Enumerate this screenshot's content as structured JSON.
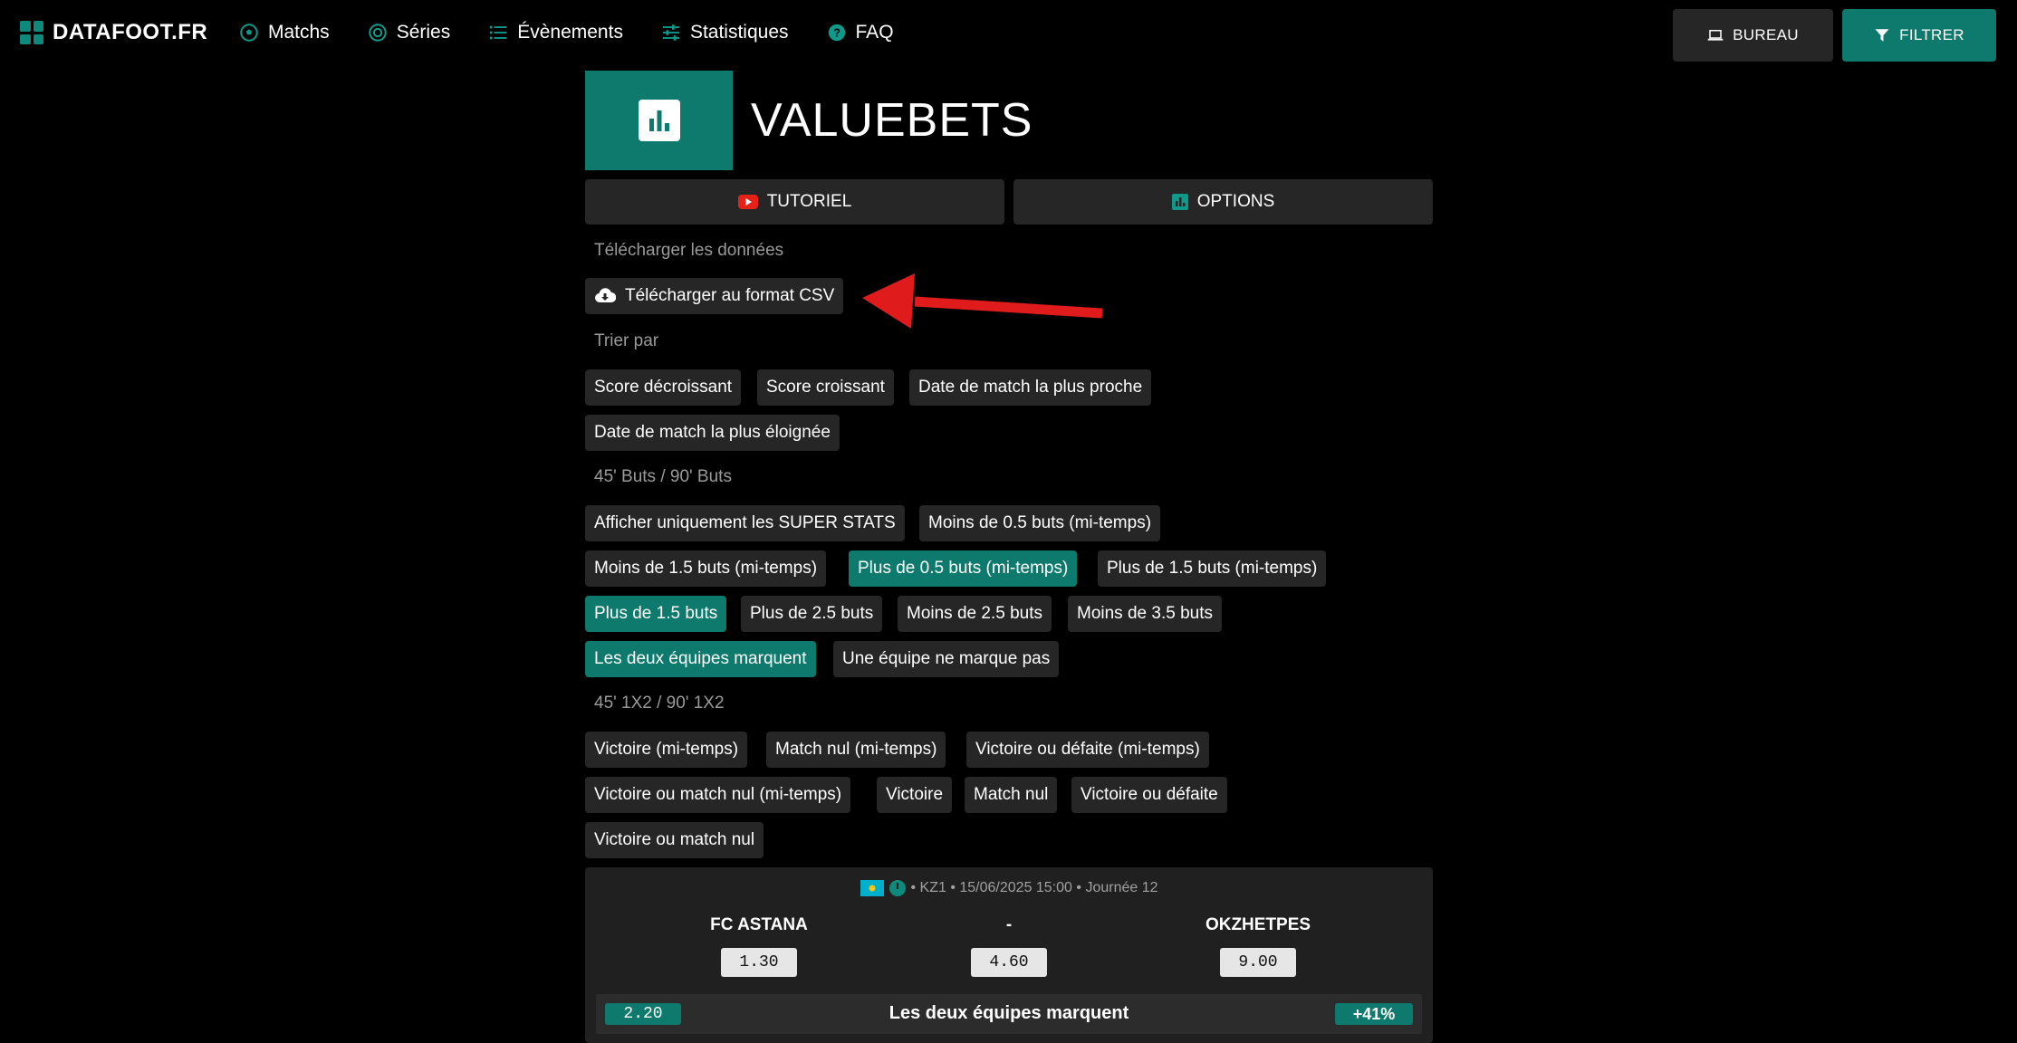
{
  "brand": "DATAFOOT.FR",
  "nav": [
    {
      "label": "Matchs",
      "icon": "soccer-ball-icon"
    },
    {
      "label": "Séries",
      "icon": "target-icon"
    },
    {
      "label": "Évènements",
      "icon": "list-icon"
    },
    {
      "label": "Statistiques",
      "icon": "sliders-icon"
    },
    {
      "label": "FAQ",
      "icon": "question-icon"
    }
  ],
  "top_buttons": {
    "bureau": "BUREAU",
    "filtrer": "FILTRER"
  },
  "page": {
    "title": "VALUEBETS"
  },
  "actions": {
    "tutoriel": "TUTORIEL",
    "options": "OPTIONS"
  },
  "download": {
    "label": "Télécharger les données",
    "button": "Télécharger au format CSV"
  },
  "sort": {
    "label": "Trier par",
    "options": [
      "Score décroissant",
      "Score croissant",
      "Date de match la plus proche",
      "Date de match la plus éloignée"
    ]
  },
  "goals": {
    "label": "45' Buts / 90' Buts",
    "options": [
      "Afficher uniquement les SUPER STATS",
      "Moins de 0.5 buts (mi-temps)",
      "Moins de 1.5 buts (mi-temps)",
      "Plus de 0.5 buts (mi-temps)",
      "Plus de 1.5 buts (mi-temps)",
      "Plus de 1.5 buts",
      "Plus de 2.5 buts",
      "Moins de 2.5 buts",
      "Moins de 3.5 buts",
      "Les deux équipes marquent",
      "Une équipe ne marque pas"
    ]
  },
  "results": {
    "label": "45' 1X2 / 90' 1X2",
    "options": [
      "Victoire (mi-temps)",
      "Match nul (mi-temps)",
      "Victoire ou défaite (mi-temps)",
      "Victoire ou match nul (mi-temps)",
      "Victoire",
      "Match nul",
      "Victoire ou défaite",
      "Victoire ou match nul"
    ]
  },
  "match": {
    "meta": "• KZ1 • 15/06/2025 15:00 • Journée 12",
    "home": "FC ASTANA",
    "separator": "-",
    "away": "OKZHETPES",
    "odd_home": "1.30",
    "odd_draw": "4.60",
    "odd_away": "9.00",
    "bet_odd": "2.20",
    "bet_label": "Les deux équipes marquent",
    "bet_pct": "+41%"
  },
  "colors": {
    "accent": "#0e7a6d",
    "chip": "#262626",
    "arrow": "#e01b1b"
  }
}
